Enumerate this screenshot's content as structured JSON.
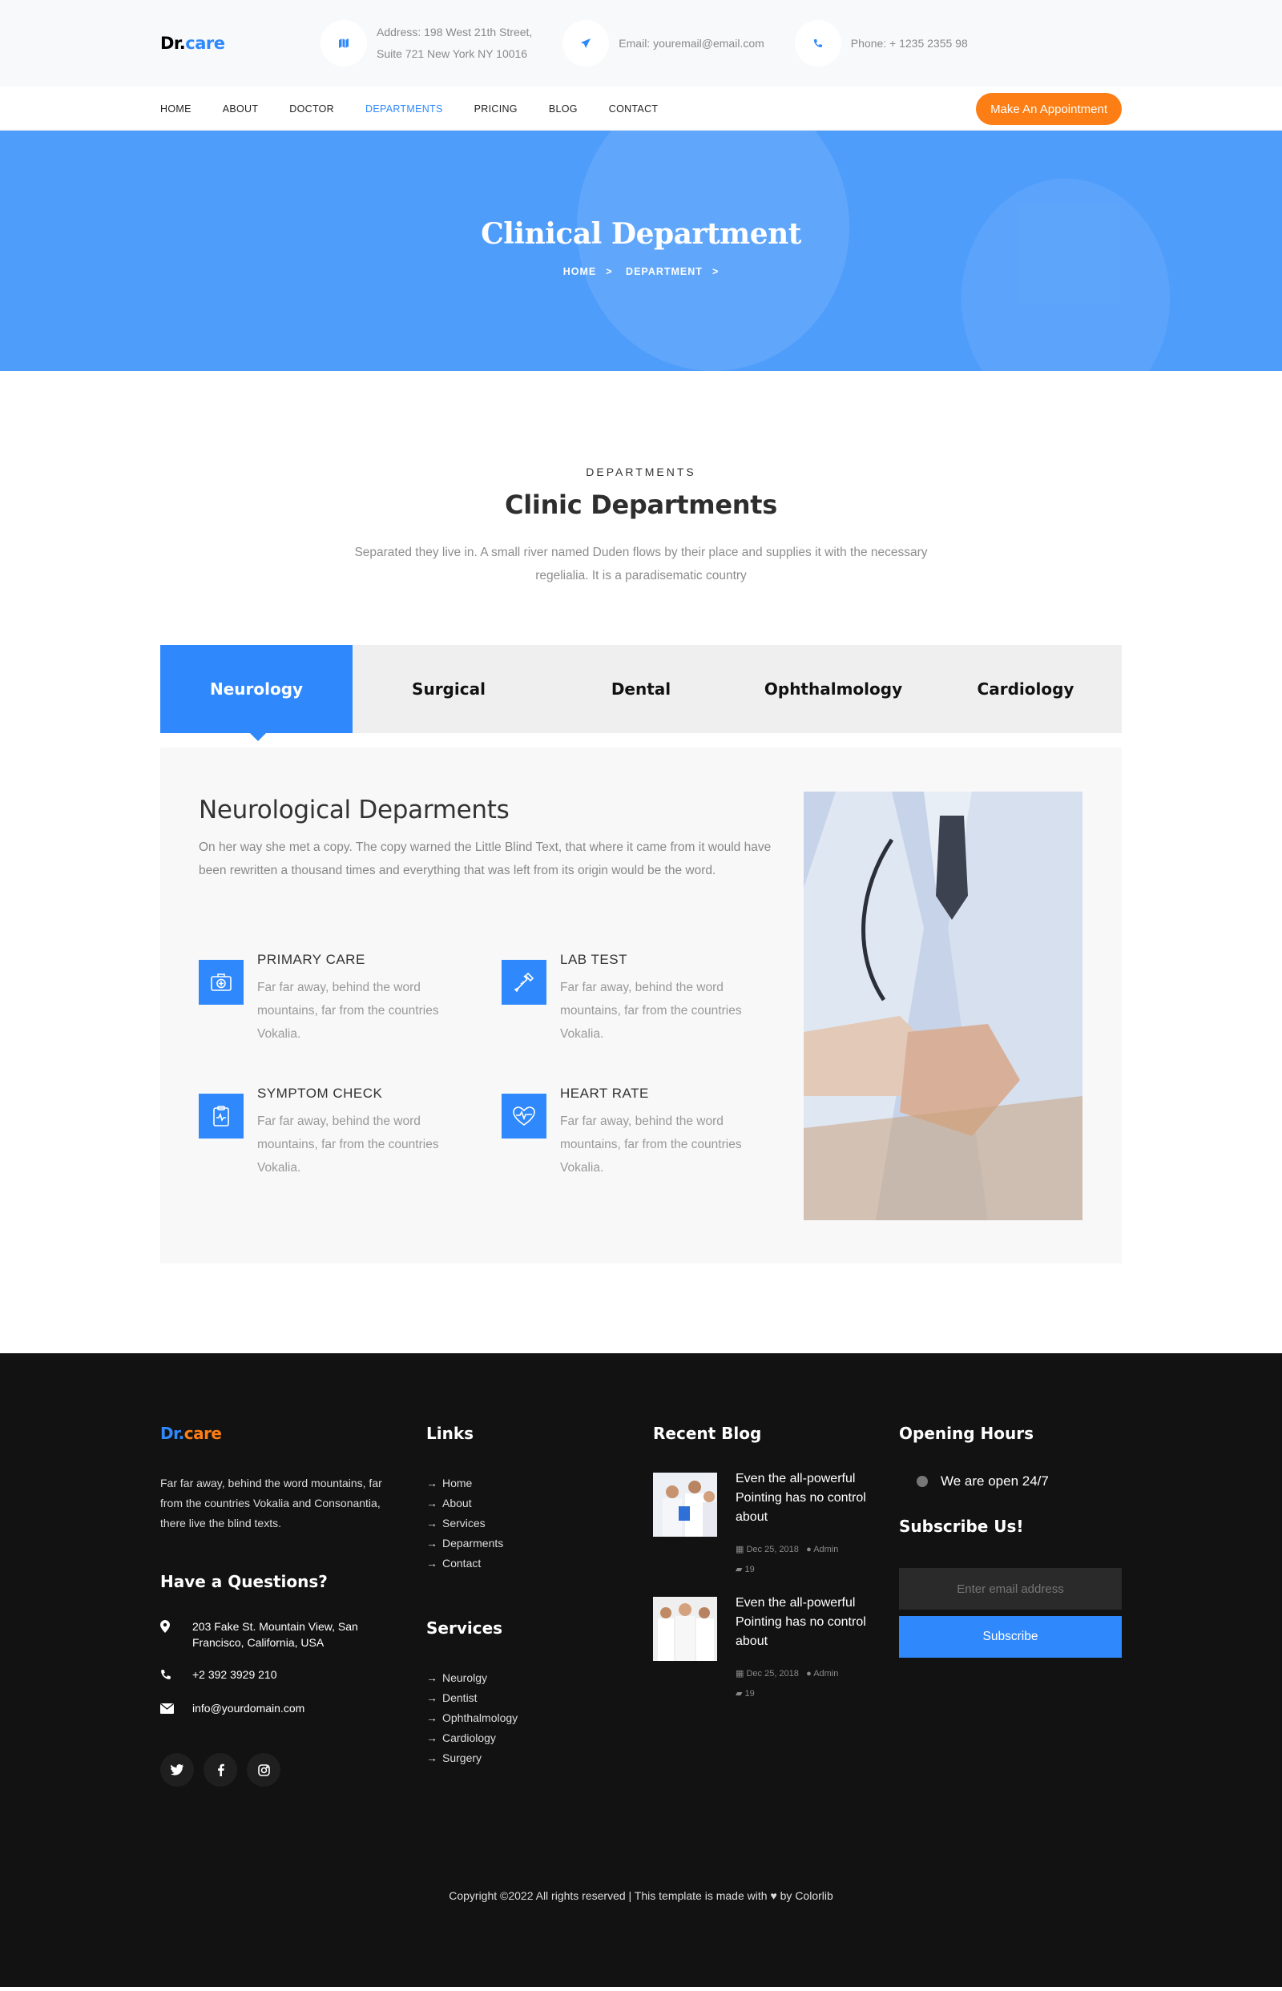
{
  "brand": {
    "logo_dr": "Dr.",
    "logo_care": "care"
  },
  "topbar": {
    "address_line1": "Address: 198 West 21th Street,",
    "address_line2": "Suite 721 New York NY 10016",
    "email": "Email: youremail@email.com",
    "phone": "Phone: + 1235 2355 98",
    "icons": [
      "map-icon",
      "paper-plane-icon",
      "phone-icon"
    ]
  },
  "nav": {
    "items": [
      "HOME",
      "ABOUT",
      "DOCTOR",
      "DEPARTMENTS",
      "PRICING",
      "BLOG",
      "CONTACT"
    ],
    "active": "DEPARTMENTS",
    "cta": "Make An Appointment"
  },
  "hero": {
    "title": "Clinical Department",
    "crumb_home": "HOME",
    "crumb_current": "DEPARTMENT",
    "crumb_separator": ">"
  },
  "departments": {
    "subheading": "DEPARTMENTS",
    "heading": "Clinic Departments",
    "description": "Separated they live in. A small river named Duden flows by their place and supplies it with the necessary regelialia. It is a paradisematic country",
    "tabs": [
      "Neurology",
      "Surgical",
      "Dental",
      "Ophthalmology",
      "Cardiology"
    ],
    "active_tab": "Neurology",
    "panel": {
      "title": "Neurological Deparments",
      "description": "On her way she met a copy. The copy warned the Little Blind Text, that where it came from it would have been rewritten a thousand times and everything that was left from its origin would be the word.",
      "features": [
        {
          "title": "PRIMARY CARE",
          "icon": "first-aid-kit-icon",
          "text": "Far far away, behind the word mountains, far from the countries Vokalia."
        },
        {
          "title": "LAB TEST",
          "icon": "pipette-icon",
          "text": "Far far away, behind the word mountains, far from the countries Vokalia."
        },
        {
          "title": "SYMPTOM CHECK",
          "icon": "clipboard-icon",
          "text": "Far far away, behind the word mountains, far from the countries Vokalia."
        },
        {
          "title": "HEART RATE",
          "icon": "heart-pulse-icon",
          "text": "Far far away, behind the word mountains, far from the countries Vokalia."
        }
      ]
    }
  },
  "footer": {
    "about": "Far far away, behind the word mountains, far from the countries Vokalia and Consonantia, there live the blind texts.",
    "questions_heading": "Have a Questions?",
    "contact": {
      "address": "203 Fake St. Mountain View, San Francisco, California, USA",
      "phone": "+2 392 3929 210",
      "email": "info@yourdomain.com"
    },
    "social": [
      "twitter-icon",
      "facebook-icon",
      "instagram-icon"
    ],
    "links_heading": "Links",
    "links": [
      "Home",
      "About",
      "Services",
      "Deparments",
      "Contact"
    ],
    "services_heading": "Services",
    "services": [
      "Neurolgy",
      "Dentist",
      "Ophthalmology",
      "Cardiology",
      "Surgery"
    ],
    "blog_heading": "Recent Blog",
    "blog": [
      {
        "title": "Even the all-powerful Pointing has no control about",
        "date": "Dec 25, 2018",
        "author": "Admin",
        "comments": "19"
      },
      {
        "title": "Even the all-powerful Pointing has no control about",
        "date": "Dec 25, 2018",
        "author": "Admin",
        "comments": "19"
      }
    ],
    "hours_heading": "Opening Hours",
    "hours": "We are open 24/7",
    "subscribe_heading": "Subscribe Us!",
    "subscribe_placeholder": "Enter email address",
    "subscribe_button": "Subscribe",
    "copyright_left": "Copyright ©2022 All rights reserved | This template is made with",
    "copyright_right": "by Colorlib"
  },
  "colors": {
    "accent": "#2f89fc",
    "orange": "#fd7e14",
    "footer_bg": "#121212",
    "hero_bg": "#4f9dfb"
  }
}
